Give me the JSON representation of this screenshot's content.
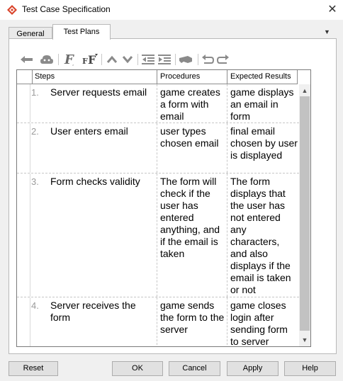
{
  "window": {
    "title": "Test Case Specification",
    "close_glyph": "✕",
    "icon": "diamond-app-icon",
    "accent_color": "#d9442b"
  },
  "tabs": [
    {
      "label": "General",
      "active": false
    },
    {
      "label": "Test Plans",
      "active": true
    }
  ],
  "tab_menu_glyph": "▼",
  "toolbar": {
    "icons": [
      "arrow-left-icon",
      "cloud-icon",
      "font-icon",
      "font-size-icon",
      "move-up-icon",
      "move-down-icon",
      "outdent-icon",
      "indent-icon",
      "highlighter-icon",
      "undo-icon",
      "redo-icon"
    ]
  },
  "table": {
    "headers": [
      "Steps",
      "Procedures",
      "Expected Results"
    ],
    "rows": [
      {
        "num": "1.",
        "step": "Server requests email",
        "procedure": "game creates a form with email",
        "expected": "game displays an email in form"
      },
      {
        "num": "2.",
        "step": "User enters email",
        "procedure": "user types chosen email",
        "expected": "final email chosen by user is displayed"
      },
      {
        "num": "3.",
        "step": "Form checks validity",
        "procedure": "The form will check if the user has entered anything, and if the email is taken",
        "expected": "The form displays that the user has not entered any characters, and also displays if the email is taken or not"
      },
      {
        "num": "4.",
        "step": "Server receives the form",
        "procedure": "game sends the form to the server",
        "expected": "game closes login after sending form to server"
      }
    ]
  },
  "scrollbar": {
    "up_glyph": "▲",
    "down_glyph": "▼"
  },
  "buttons": {
    "reset": "Reset",
    "ok": "OK",
    "cancel": "Cancel",
    "apply": "Apply",
    "help": "Help"
  }
}
